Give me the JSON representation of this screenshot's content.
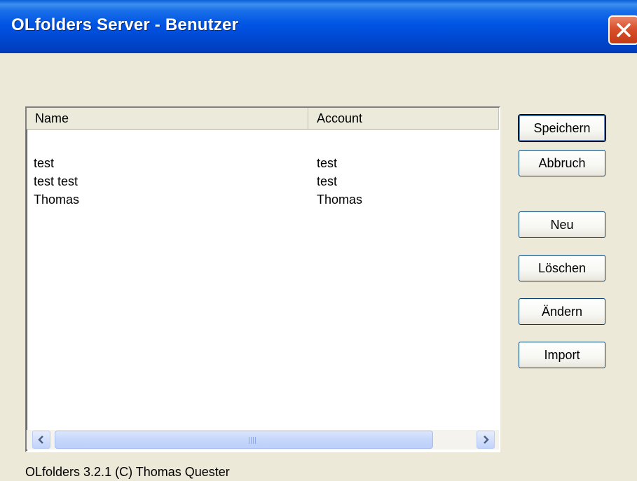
{
  "window": {
    "title": "OLfolders Server - Benutzer",
    "close_icon": "close-icon"
  },
  "list": {
    "columns": [
      "Name",
      "Account"
    ],
    "rows": [
      {
        "name": "test",
        "account": "test"
      },
      {
        "name": "test test",
        "account": "test"
      },
      {
        "name": "Thomas",
        "account": "Thomas"
      }
    ]
  },
  "buttons": {
    "save": "Speichern",
    "cancel": "Abbruch",
    "new": "Neu",
    "delete": "Löschen",
    "change": "Ändern",
    "import": "Import"
  },
  "status": "OLfolders 3.2.1 (C) Thomas Quester",
  "colors": {
    "titlebar": "#0055e5",
    "window_bg": "#ece9d8",
    "close_button": "#d8502b"
  }
}
